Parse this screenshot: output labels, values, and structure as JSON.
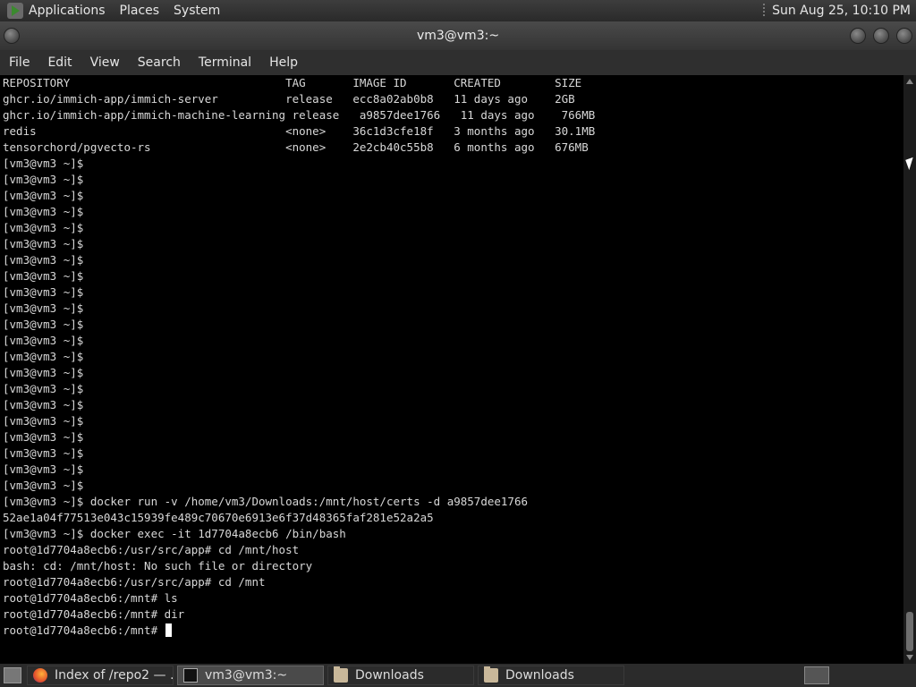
{
  "top_panel": {
    "menus": [
      "Applications",
      "Places",
      "System"
    ],
    "clock": "Sun Aug 25, 10:10 PM"
  },
  "window": {
    "title": "vm3@vm3:~"
  },
  "menu_bar": [
    "File",
    "Edit",
    "View",
    "Search",
    "Terminal",
    "Help"
  ],
  "terminal": {
    "lines": [
      "REPOSITORY                                TAG       IMAGE ID       CREATED        SIZE",
      "ghcr.io/immich-app/immich-server          release   ecc8a02ab0b8   11 days ago    2GB",
      "ghcr.io/immich-app/immich-machine-learning release   a9857dee1766   11 days ago    766MB",
      "redis                                     <none>    36c1d3cfe18f   3 months ago   30.1MB",
      "tensorchord/pgvecto-rs                    <none>    2e2cb40c55b8   6 months ago   676MB",
      "[vm3@vm3 ~]$",
      "[vm3@vm3 ~]$",
      "[vm3@vm3 ~]$",
      "[vm3@vm3 ~]$",
      "[vm3@vm3 ~]$",
      "[vm3@vm3 ~]$",
      "[vm3@vm3 ~]$",
      "[vm3@vm3 ~]$",
      "[vm3@vm3 ~]$",
      "[vm3@vm3 ~]$",
      "[vm3@vm3 ~]$",
      "[vm3@vm3 ~]$",
      "[vm3@vm3 ~]$",
      "[vm3@vm3 ~]$",
      "[vm3@vm3 ~]$",
      "[vm3@vm3 ~]$",
      "[vm3@vm3 ~]$",
      "[vm3@vm3 ~]$",
      "[vm3@vm3 ~]$",
      "[vm3@vm3 ~]$",
      "[vm3@vm3 ~]$",
      "[vm3@vm3 ~]$ docker run -v /home/vm3/Downloads:/mnt/host/certs -d a9857dee1766",
      "52ae1a04f77513e043c15939fe489c70670e6913e6f37d48365faf281e52a2a5",
      "[vm3@vm3 ~]$ docker exec -it 1d7704a8ecb6 /bin/bash",
      "root@1d7704a8ecb6:/usr/src/app# cd /mnt/host",
      "bash: cd: /mnt/host: No such file or directory",
      "root@1d7704a8ecb6:/usr/src/app# cd /mnt",
      "root@1d7704a8ecb6:/mnt# ls",
      "root@1d7704a8ecb6:/mnt# dir",
      "root@1d7704a8ecb6:/mnt# "
    ]
  },
  "taskbar": {
    "tasks": [
      {
        "label": "Index of /repo2 — …",
        "icon": "firefox-icon"
      },
      {
        "label": "vm3@vm3:~",
        "icon": "terminal-icon"
      },
      {
        "label": "Downloads",
        "icon": "folder-icon"
      },
      {
        "label": "Downloads",
        "icon": "folder-icon"
      }
    ]
  }
}
